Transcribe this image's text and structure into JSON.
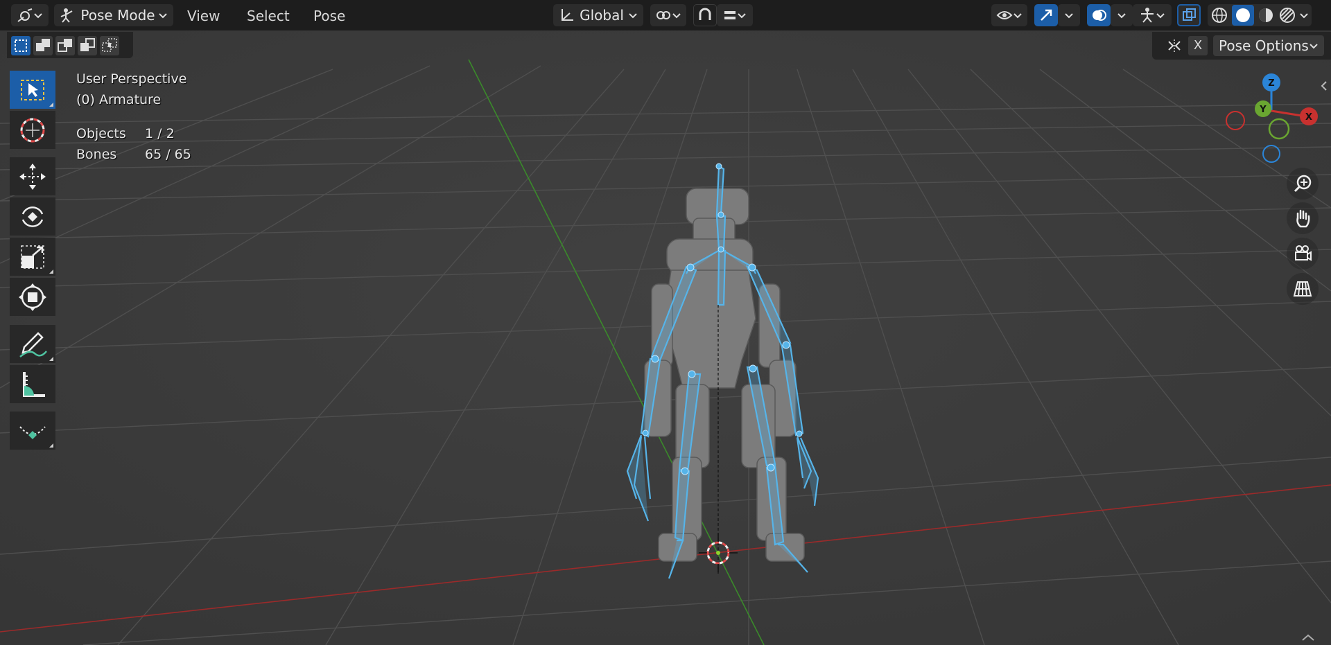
{
  "header": {
    "mode_label": "Pose Mode",
    "menus": [
      "View",
      "Select",
      "Pose"
    ],
    "orientation_label": "Global",
    "pose_options_label": "Pose Options",
    "close_label": "X"
  },
  "overlay_info": {
    "view_name": "User Perspective",
    "object_name": "(0) Armature",
    "stats": [
      {
        "label": "Objects",
        "value": "1 / 2"
      },
      {
        "label": "Bones",
        "value": "65 / 65"
      }
    ]
  },
  "gizmo": {
    "axes": [
      "Z",
      "Y",
      "X"
    ],
    "colors": {
      "x": "#c8312f",
      "y": "#6aa631",
      "z": "#2b85d8"
    }
  },
  "toolbar": {
    "tools": [
      "select-box-tool",
      "cursor-tool",
      "move-tool",
      "rotate-tool",
      "scale-tool",
      "transform-tool",
      "annotate-tool",
      "measure-tool",
      "relax-pose-tool"
    ],
    "active_tool": "select-box-tool"
  },
  "navigation": [
    "zoom-icon",
    "pan-hand-icon",
    "camera-view-icon",
    "grid-view-icon"
  ],
  "colors": {
    "accent": "#1c5ea8",
    "bone": "#56b4e9",
    "x_axis": "#9b2a2a",
    "y_axis": "#3a8a2a"
  }
}
